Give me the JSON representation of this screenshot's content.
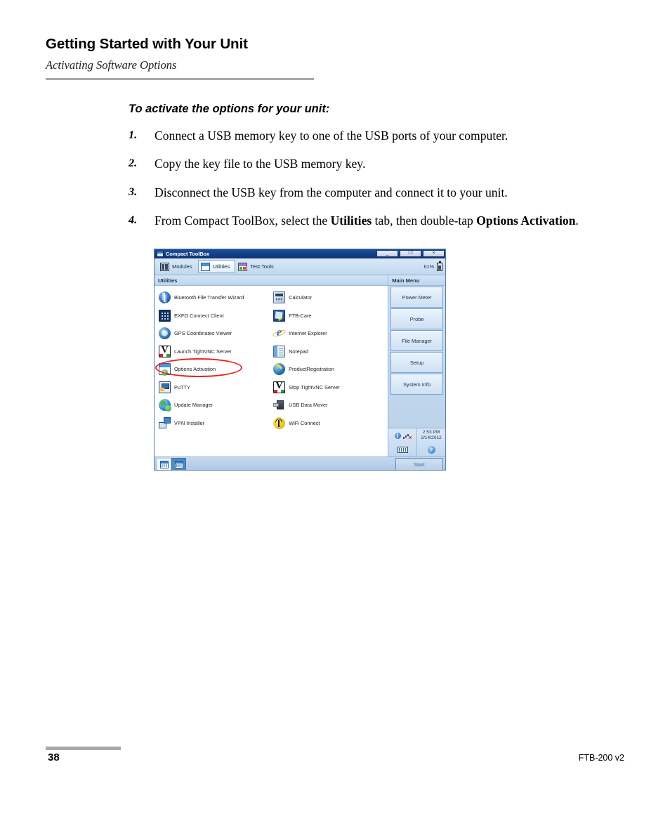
{
  "header": {
    "chapter_title": "Getting Started with Your Unit",
    "section_title": "Activating Software Options"
  },
  "procedure": {
    "heading": "To activate the options for your unit:",
    "steps": [
      {
        "num": "1.",
        "text": "Connect a USB memory key to one of the USB ports of your computer."
      },
      {
        "num": "2.",
        "text": "Copy the key file to the USB memory key."
      },
      {
        "num": "3.",
        "text": "Disconnect the USB key from the computer and connect it to your unit."
      },
      {
        "num": "4.",
        "text_before": "From Compact ToolBox, select the ",
        "bold1": "Utilities",
        "text_middle": " tab, then double-tap ",
        "bold2": "Options Activation",
        "text_after": "."
      }
    ]
  },
  "device_screenshot": {
    "window_title": "Compact ToolBox",
    "window_buttons": {
      "minimize": "_",
      "restore": "❐",
      "close": "×"
    },
    "tabs": [
      {
        "label": "Modules",
        "icon": "modules-icon",
        "selected": false
      },
      {
        "label": "Utilities",
        "icon": "window-icon",
        "selected": true
      },
      {
        "label": "Test Tools",
        "icon": "test-tools-icon",
        "selected": false
      }
    ],
    "battery": {
      "percent": "61%",
      "icon": "battery-icon"
    },
    "left_pane": {
      "header": "Utilities",
      "items": [
        {
          "label": "Bluetooth File Transfer Wizard",
          "icon": "bluetooth-icon"
        },
        {
          "label": "Calculator",
          "icon": "calculator-icon"
        },
        {
          "label": "EXFO Connect Client",
          "icon": "exfo-connect-icon"
        },
        {
          "label": "FTB-Care",
          "icon": "ftb-care-icon"
        },
        {
          "label": "GPS Coordinates Viewer",
          "icon": "gps-icon"
        },
        {
          "label": "Internet Explorer",
          "icon": "internet-explorer-icon"
        },
        {
          "label": "Launch TightVNC Server",
          "icon": "tightvnc-icon"
        },
        {
          "label": "Notepad",
          "icon": "notepad-icon"
        },
        {
          "label": "Options Activation",
          "icon": "options-activation-icon"
        },
        {
          "label": "ProductRegistration",
          "icon": "product-registration-icon"
        },
        {
          "label": "PuTTY",
          "icon": "putty-icon"
        },
        {
          "label": "Stop TightVNC Server",
          "icon": "tightvnc-icon"
        },
        {
          "label": "Update Manager",
          "icon": "update-manager-icon"
        },
        {
          "label": "USB Data Mover",
          "icon": "usb-data-mover-icon"
        },
        {
          "label": "VPN Installer",
          "icon": "vpn-installer-icon"
        },
        {
          "label": "WiFi Connect",
          "icon": "wifi-connect-icon"
        }
      ],
      "highlighted_item": "Options Activation",
      "highlight_color": "#e8241f"
    },
    "right_pane": {
      "header": "Main Menu",
      "buttons": [
        "Power Meter",
        "Probe",
        "File Manager",
        "Setup",
        "System Info"
      ]
    },
    "system_tray": {
      "bluetooth_icon": "bluetooth-icon",
      "signal_icon": "signal-disconnected-icon",
      "time": "2:53 PM",
      "date": "2/14/2012",
      "keyboard_icon": "keyboard-icon",
      "help_icon": "help-icon"
    },
    "taskbar": {
      "buttons": [
        {
          "icon": "window-grid-icon",
          "active": false
        },
        {
          "icon": "window-grid-icon",
          "active": true
        }
      ],
      "start_label": "Start"
    }
  },
  "footer": {
    "page_number": "38",
    "product": "FTB-200 v2"
  }
}
